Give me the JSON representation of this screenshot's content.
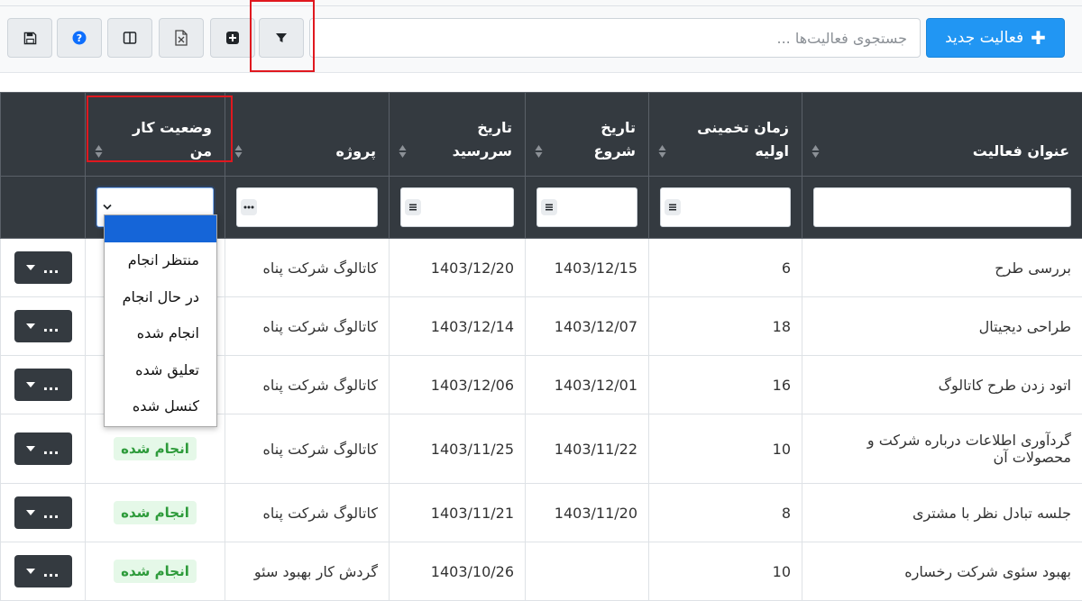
{
  "toolbar": {
    "new_activity_label": "فعالیت جدید",
    "search_placeholder": "جستجوی فعالیت‌ها ...",
    "buttons": [
      "filter-icon",
      "plus-square-icon",
      "excel-file-icon",
      "columns-icon",
      "help-icon",
      "save-icon"
    ]
  },
  "table": {
    "headers": [
      "عنوان فعالیت",
      "زمان تخمینی اولیه",
      "تاریخ شروع",
      "تاریخ سررسید",
      "پروژه",
      "وضعیت کار من",
      ""
    ],
    "rows": [
      {
        "title": "بررسی طرح",
        "estimate": "6",
        "start": "1403/12/15",
        "due": "1403/12/20",
        "project": "کاتالوگ شرکت پناه",
        "status": ""
      },
      {
        "title": "طراحی دیجیتال",
        "estimate": "18",
        "start": "1403/12/07",
        "due": "1403/12/14",
        "project": "کاتالوگ شرکت پناه",
        "status": ""
      },
      {
        "title": "اتود زدن طرح کاتالوگ",
        "estimate": "16",
        "start": "1403/12/01",
        "due": "1403/12/06",
        "project": "کاتالوگ شرکت پناه",
        "status": ""
      },
      {
        "title": "گردآوری اطلاعات درباره شرکت و محصولات آن",
        "estimate": "10",
        "start": "1403/11/22",
        "due": "1403/11/25",
        "project": "کاتالوگ شرکت پناه",
        "status": "انجام شده"
      },
      {
        "title": "جلسه تبادل نظر با مشتری",
        "estimate": "8",
        "start": "1403/11/20",
        "due": "1403/11/21",
        "project": "کاتالوگ شرکت پناه",
        "status": "انجام شده"
      },
      {
        "title": "بهبود سئوی شرکت رخساره",
        "estimate": "10",
        "start": "",
        "due": "1403/10/26",
        "project": "گردش کار بهبود سئو",
        "status": "انجام شده"
      }
    ],
    "action_label": "..."
  },
  "status_dropdown": {
    "options": [
      "منتظر انجام",
      "در حال انجام",
      "انجام شده",
      "تعلیق شده",
      "کنسل شده"
    ]
  },
  "colors": {
    "primary": "#2196f3",
    "header_bg": "#343a40",
    "highlight": "#e0181f",
    "badge_bg": "#e5f8e8",
    "badge_text": "#2e9b3b",
    "dropdown_selected": "#1565d8"
  }
}
